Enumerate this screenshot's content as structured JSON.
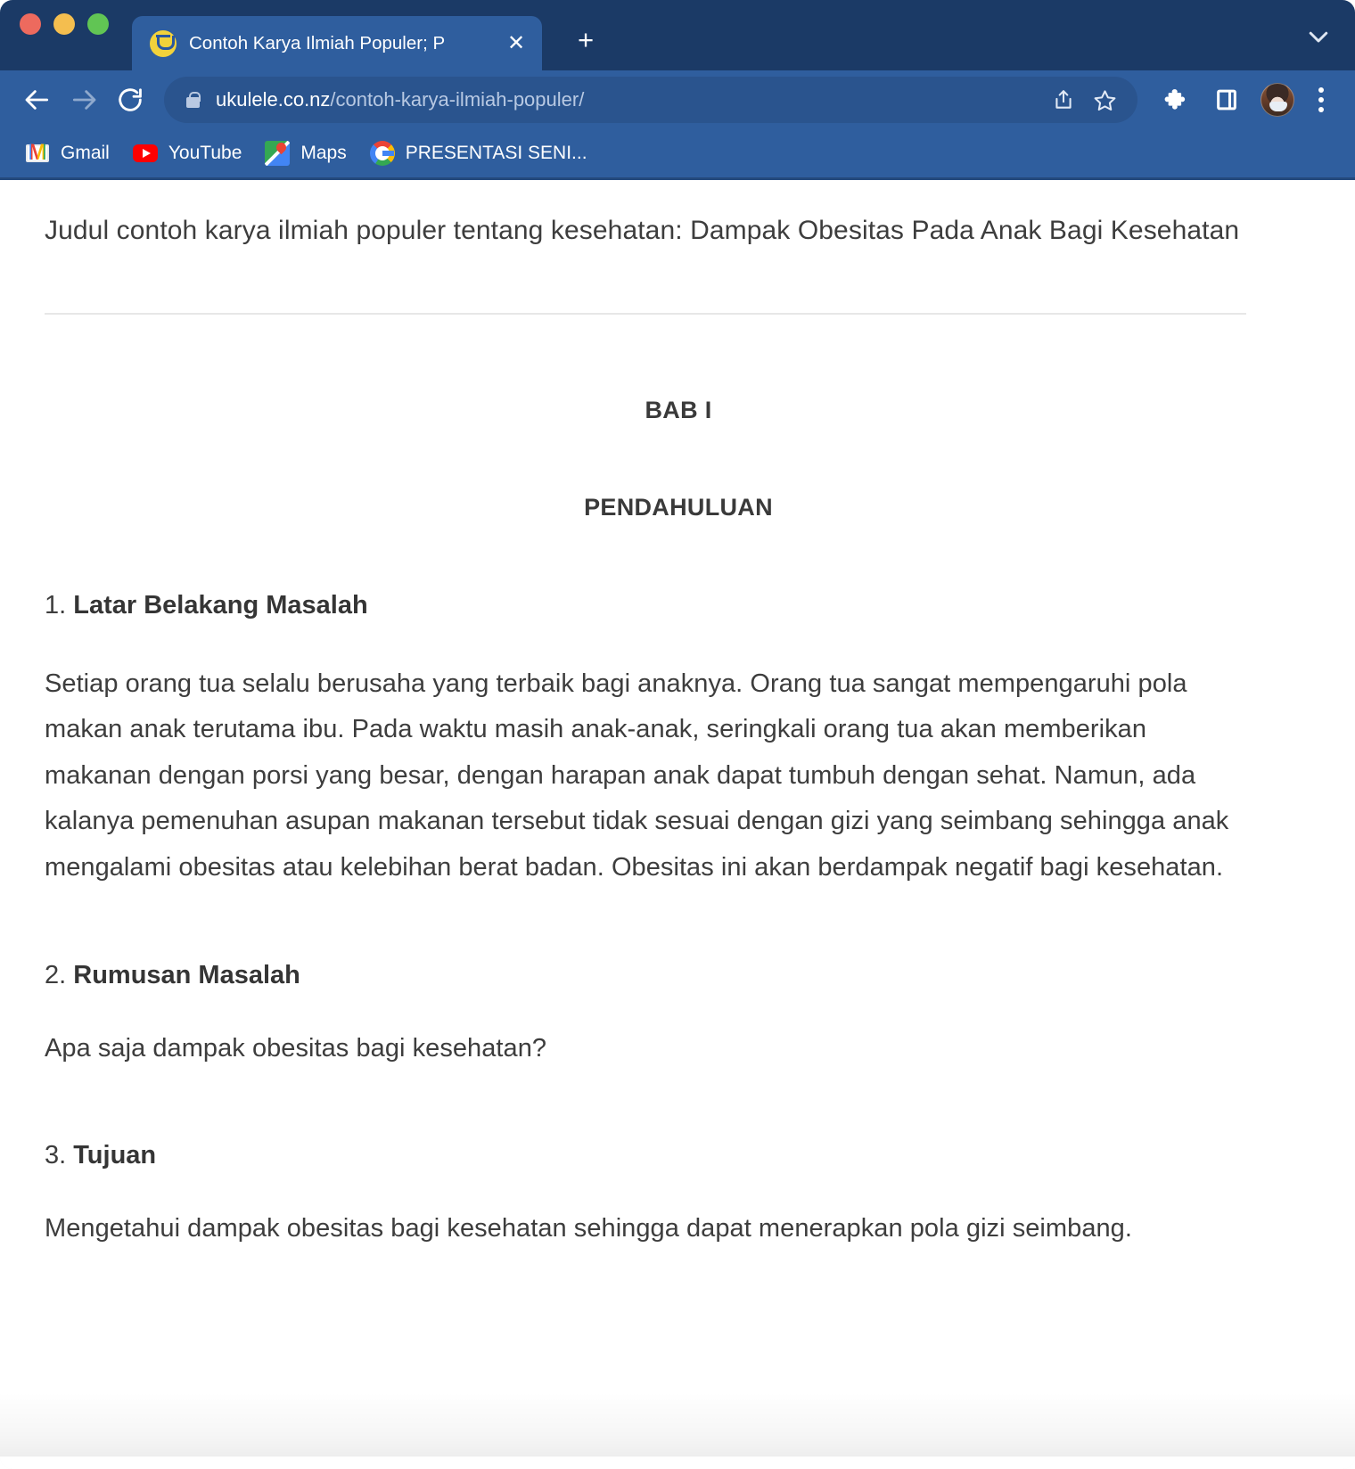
{
  "window": {
    "traffic_lights": [
      "close",
      "minimize",
      "zoom"
    ],
    "chevron_icon": "chevron-down-icon"
  },
  "tabs": [
    {
      "title": "Contoh Karya Ilmiah Populer; P",
      "favicon": "ukulele-favicon",
      "close_label": "✕",
      "active": true
    }
  ],
  "new_tab_label": "+",
  "toolbar": {
    "back_icon": "back-arrow-icon",
    "forward_icon": "forward-arrow-icon",
    "reload_icon": "reload-icon",
    "lock_icon": "lock-icon",
    "url_host": "ukulele.co.nz",
    "url_path": "/contoh-karya-ilmiah-populer/",
    "share_icon": "share-icon",
    "bookmark_icon": "star-icon",
    "extensions_icon": "puzzle-icon",
    "sidepanel_icon": "side-panel-icon",
    "profile_icon": "profile-avatar",
    "menu_icon": "kebab-menu-icon"
  },
  "bookmarks": [
    {
      "label": "Gmail",
      "icon": "gmail-icon"
    },
    {
      "label": "YouTube",
      "icon": "youtube-icon"
    },
    {
      "label": "Maps",
      "icon": "maps-icon"
    },
    {
      "label": "PRESENTASI SENI...",
      "icon": "google-icon"
    }
  ],
  "page": {
    "doc_title": "Judul contoh karya ilmiah populer tentang kesehatan: Dampak Obesitas Pada Anak Bagi Kesehatan",
    "chapter_heading": "BAB I",
    "section_heading": "PENDAHULUAN",
    "sections": [
      {
        "number": "1. ",
        "heading": "Latar Belakang Masalah",
        "body": "Setiap orang tua selalu berusaha yang terbaik bagi anaknya. Orang tua sangat mempengaruhi pola makan anak terutama ibu. Pada waktu masih anak-anak, seringkali orang tua akan memberikan makanan dengan porsi yang besar, dengan harapan anak dapat tumbuh dengan sehat. Namun, ada kalanya pemenuhan asupan makanan tersebut tidak sesuai dengan gizi yang seimbang sehingga anak mengalami obesitas atau kelebihan berat badan. Obesitas ini akan berdampak negatif bagi kesehatan."
      },
      {
        "number": "2. ",
        "heading": "Rumusan Masalah",
        "body": "Apa saja dampak obesitas bagi kesehatan?"
      },
      {
        "number": "3. ",
        "heading": "Tujuan",
        "body": "Mengetahui dampak obesitas bagi kesehatan sehingga dapat menerapkan pola gizi seimbang."
      }
    ]
  },
  "colors": {
    "titlebar": "#1b3a66",
    "toolbar": "#2f5e9e",
    "omnibox": "#2a548e",
    "page_background": "#ffffff",
    "body_text": "#3d3d3d",
    "divider": "#e7e7e7"
  }
}
